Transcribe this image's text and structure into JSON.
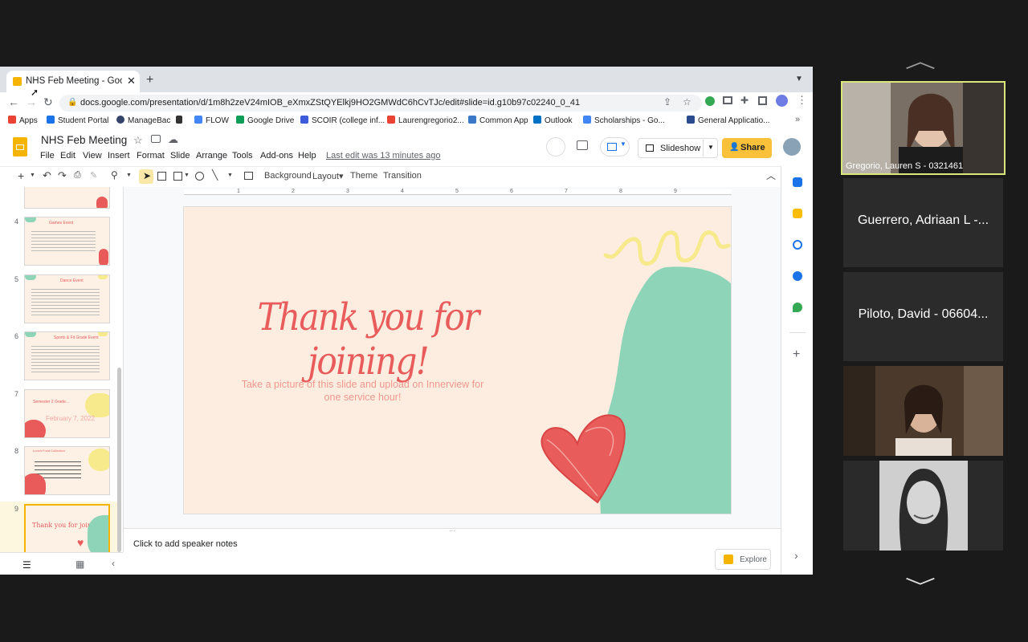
{
  "browser": {
    "tab_title": "NHS Feb Meeting - Google Slides",
    "url": "docs.google.com/presentation/d/1m8h2zeV24mIOB_eXmxZStQYElkj9HO2GMWdC6hCvTJc/edit#slide=id.g10b97c02240_0_41",
    "bookmarks": [
      "Apps",
      "Student Portal",
      "ManageBac",
      "",
      "FLOW",
      "Google Drive",
      "SCOIR (college inf...",
      "Laurengregorio2...",
      "Common App",
      "Outlook",
      "Scholarships - Go...",
      "General Applicatio..."
    ]
  },
  "slides": {
    "doc_title": "NHS Feb Meeting",
    "menu": [
      "File",
      "Edit",
      "View",
      "Insert",
      "Format",
      "Slide",
      "Arrange",
      "Tools",
      "Add-ons",
      "Help"
    ],
    "last_edit": "Last edit was 13 minutes ago",
    "slideshow_label": "Slideshow",
    "share_label": "Share",
    "toolbar": {
      "background": "Background",
      "layout": "Layout▾",
      "theme": "Theme",
      "transition": "Transition"
    },
    "thumbnails": [
      {
        "num": "4",
        "title": "Games Event",
        "color": "#f5b3a8"
      },
      {
        "num": "5",
        "title": "Dance Event",
        "color": "#f5b3a8"
      },
      {
        "num": "6",
        "title": "Sports & Fit Grade Event",
        "color": "#f5b3a8"
      },
      {
        "num": "7",
        "title": "Semester 2 Grade...",
        "subtitle": "February 7, 2022",
        "color": "#f5b3a8"
      },
      {
        "num": "8",
        "title": "Lunch Fund Collection",
        "color": "#f5b3a8"
      },
      {
        "num": "9",
        "title": "Thank you for joining!",
        "color": "#e95a5a"
      }
    ],
    "notes_placeholder": "Click to add speaker notes",
    "explore_label": "Explore",
    "ruler_ticks": [
      "1",
      "2",
      "3",
      "4",
      "5",
      "6",
      "7",
      "8",
      "9"
    ],
    "slide": {
      "heading": "Thank you for joining!",
      "body": "Take a picture of this slide and upload on Innerview for one service hour!",
      "heading_color": "#e85c5c",
      "body_color": "#f0998f",
      "blob_color": "#8ed4b8",
      "squiggle_color": "#f7ea8c"
    }
  },
  "meeting": {
    "participants": [
      {
        "name": "Gregorio, Lauren S - 0321461",
        "video": true
      },
      {
        "name": "Guerrero, Adriaan L -...",
        "video": false
      },
      {
        "name": "Piloto, David - 06604...",
        "video": false
      },
      {
        "name": "",
        "video": true
      },
      {
        "name": "",
        "video": true
      }
    ]
  }
}
